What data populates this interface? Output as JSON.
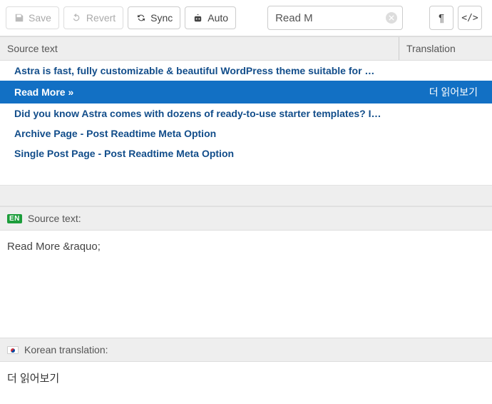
{
  "toolbar": {
    "save_label": "Save",
    "revert_label": "Revert",
    "sync_label": "Sync",
    "auto_label": "Auto",
    "search_value": "Read M",
    "pilcrow": "¶",
    "code_view": "</>"
  },
  "columns": {
    "source": "Source text",
    "translation": "Translation"
  },
  "rows": [
    {
      "source": "Astra is fast, fully customizable & beautiful WordPress theme suitable for …",
      "translation": "",
      "selected": false
    },
    {
      "source": "Read More »",
      "translation": "더 읽어보기",
      "selected": true
    },
    {
      "source": "Did you know Astra comes with dozens of ready-to-use starter templates? I…",
      "translation": "",
      "selected": false
    },
    {
      "source": "Archive Page - Post Readtime Meta Option",
      "translation": "",
      "selected": false
    },
    {
      "source": "Single Post Page - Post Readtime Meta Option",
      "translation": "",
      "selected": false
    }
  ],
  "source_panel": {
    "badge": "EN",
    "label": "Source text:",
    "content": "Read More &raquo;"
  },
  "translation_panel": {
    "label": "Korean translation:",
    "content": "더 읽어보기"
  }
}
